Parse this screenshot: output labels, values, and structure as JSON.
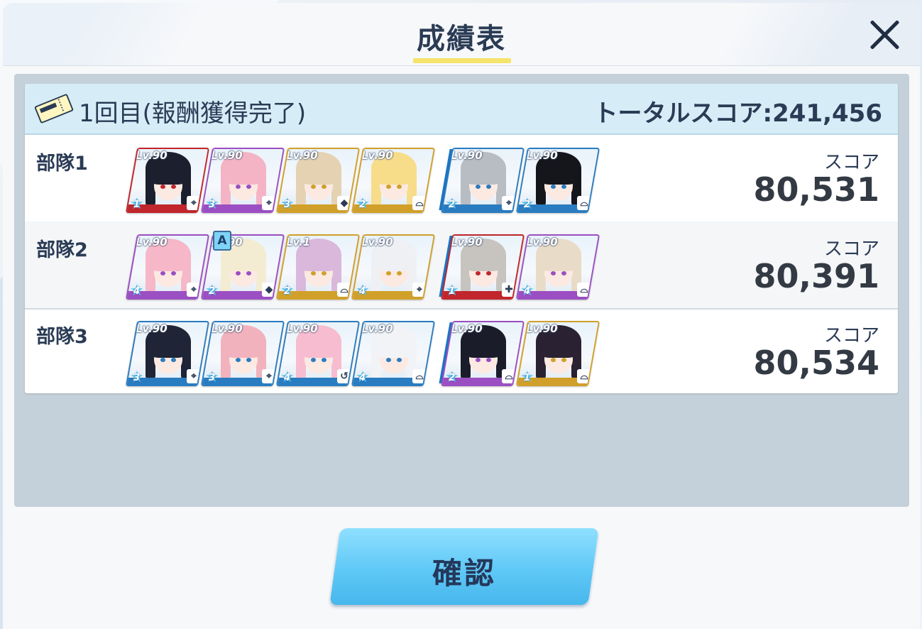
{
  "dialog": {
    "title": "成績表",
    "close_icon": "close-icon"
  },
  "result": {
    "round_label": "1回目(報酬獲得完了)",
    "total_score": "トータルスコア:241,456",
    "ticket_icon": "ticket-icon"
  },
  "squads": [
    {
      "name": "部隊1",
      "score_label": "スコア",
      "score": "80,531",
      "units": [
        {
          "level": "Lv.90",
          "star": "1",
          "role": "crosshair-icon",
          "rarity_color": "#c0262c",
          "hair": "#1b1f2e"
        },
        {
          "level": "Lv.90",
          "star": "3",
          "role": "crosshair-icon",
          "rarity_color": "#9b4fc2",
          "hair": "#f4b4c6"
        },
        {
          "level": "Lv.90",
          "star": "3",
          "role": "shield-icon",
          "rarity_color": "#d0a02a",
          "hair": "#e5d2b2"
        },
        {
          "level": "Lv.90",
          "star": "2",
          "role": "support-icon",
          "rarity_color": "#d0a02a",
          "hair": "#f7dc8a"
        },
        {
          "level": "Lv.90",
          "star": "2",
          "role": "crosshair-icon",
          "rarity_color": "#2a7cc0",
          "hair": "#b8bcc3"
        },
        {
          "level": "Lv.90",
          "star": "2",
          "role": "support-icon",
          "rarity_color": "#2a7cc0",
          "hair": "#15161c"
        }
      ]
    },
    {
      "name": "部隊2",
      "score_label": "スコア",
      "score": "80,391",
      "badge": "A",
      "units": [
        {
          "level": "Lv.90",
          "star": "4",
          "role": "crosshair-icon",
          "rarity_color": "#9b4fc2",
          "hair": "#f6b7c9"
        },
        {
          "level": "Lv.90",
          "star": "2",
          "role": "shield-icon",
          "rarity_color": "#9b4fc2",
          "hair": "#f4ecd2"
        },
        {
          "level": "Lv.1",
          "star": "2",
          "role": "support-icon",
          "rarity_color": "#d0a02a",
          "hair": "#d9b8dc"
        },
        {
          "level": "Lv.90",
          "star": "4",
          "role": "crosshair-icon",
          "rarity_color": "#d0a02a",
          "hair": "#eef0f4"
        },
        {
          "level": "Lv.90",
          "star": "1",
          "role": "heal-icon",
          "rarity_color": "#c0262c",
          "hair": "#c7c4c0"
        },
        {
          "level": "Lv.90",
          "star": "4",
          "role": "support-icon",
          "rarity_color": "#9b4fc2",
          "hair": "#e8dcc8"
        }
      ]
    },
    {
      "name": "部隊3",
      "score_label": "スコア",
      "score": "80,534",
      "units": [
        {
          "level": "Lv.90",
          "star": "3",
          "role": "crosshair-icon",
          "rarity_color": "#2a7cc0",
          "hair": "#1f2436"
        },
        {
          "level": "Lv.90",
          "star": "3",
          "role": "crosshair-icon",
          "rarity_color": "#2a7cc0",
          "hair": "#f2b2bd"
        },
        {
          "level": "Lv.90",
          "star": "4",
          "role": "refresh-icon",
          "rarity_color": "#2a7cc0",
          "hair": "#f7bcd0"
        },
        {
          "level": "Lv.90",
          "star": "4",
          "role": "support-icon",
          "rarity_color": "#2a7cc0",
          "hair": "#f2f3f6"
        },
        {
          "level": "Lv.90",
          "star": "2",
          "role": "support-icon",
          "rarity_color": "#9b4fc2",
          "hair": "#1a1c2a"
        },
        {
          "level": "Lv.90",
          "star": "1",
          "role": "support-icon",
          "rarity_color": "#d0a02a",
          "hair": "#2a2233"
        }
      ]
    }
  ],
  "confirm": {
    "label": "確認"
  }
}
